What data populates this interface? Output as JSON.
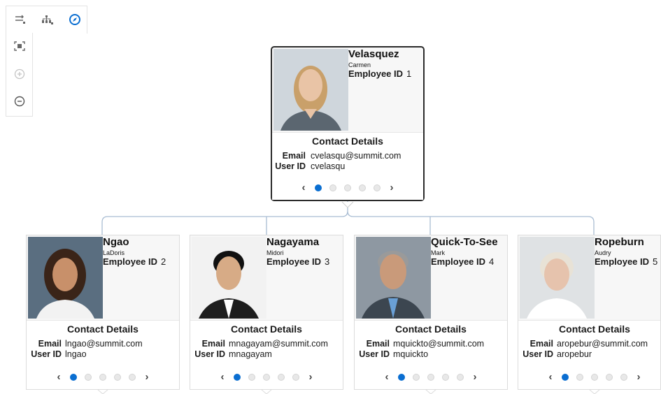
{
  "toolbar": {
    "buttons": [
      "layout-horizontal-icon",
      "layout-hierarchy-icon",
      "navigate-compass-icon",
      "fit-to-screen-icon",
      "zoom-in-icon",
      "zoom-out-icon"
    ]
  },
  "card_labels": {
    "contact_title": "Contact Details",
    "employee_id_label": "Employee ID",
    "email_label": "Email",
    "user_id_label": "User ID",
    "prev": "‹",
    "next": "›"
  },
  "colors": {
    "accent": "#0a6ed1",
    "link_line": "#9fb4cc"
  },
  "root": {
    "last_name": "Velasquez",
    "first_name": "Carmen",
    "employee_id": "1",
    "email": "cvelasqu@summit.com",
    "user_id": "cvelasqu"
  },
  "children": [
    {
      "last_name": "Ngao",
      "first_name": "LaDoris",
      "employee_id": "2",
      "email": "lngao@summit.com",
      "user_id": "lngao"
    },
    {
      "last_name": "Nagayama",
      "first_name": "Midori",
      "employee_id": "3",
      "email": "mnagayam@summit.com",
      "user_id": "mnagayam"
    },
    {
      "last_name": "Quick-To-See",
      "first_name": "Mark",
      "employee_id": "4",
      "email": "mquickto@summit.com",
      "user_id": "mquickto"
    },
    {
      "last_name": "Ropeburn",
      "first_name": "Audry",
      "employee_id": "5",
      "email": "aropebur@summit.com",
      "user_id": "aropebur"
    }
  ]
}
